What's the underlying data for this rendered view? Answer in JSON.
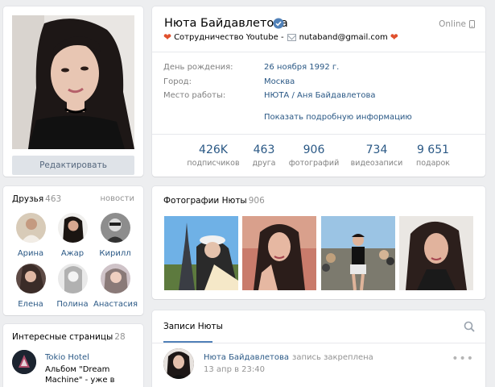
{
  "profile": {
    "name": "Нюта Байдавлетова",
    "online": "Online",
    "status_text": "Сотрудничество Youtube -",
    "status_email": "nutaband@gmail.com",
    "edit_button": "Редактировать",
    "info": [
      {
        "label": "День рождения:",
        "value": "26 ноября 1992 г."
      },
      {
        "label": "Город:",
        "value": "Москва"
      },
      {
        "label": "Место работы:",
        "value": "НЮТА / Аня Байдавлетова"
      }
    ],
    "show_more": "Показать подробную информацию",
    "counters": [
      {
        "value": "426K",
        "label": "подписчиков"
      },
      {
        "value": "463",
        "label": "друга"
      },
      {
        "value": "906",
        "label": "фотографий"
      },
      {
        "value": "734",
        "label": "видеозаписи"
      },
      {
        "value": "9 651",
        "label": "подарок"
      }
    ]
  },
  "friends": {
    "title": "Друзья",
    "count": "463",
    "link": "новости",
    "items": [
      {
        "name": "Арина"
      },
      {
        "name": "Ажар"
      },
      {
        "name": "Кирилл"
      },
      {
        "name": "Елена"
      },
      {
        "name": "Полина"
      },
      {
        "name": "Анастасия"
      }
    ]
  },
  "pages": {
    "title": "Интересные страницы",
    "count": "28",
    "items": [
      {
        "title": "Tokio Hotel",
        "desc": "Альбом \"Dream Machine\" - уже в группе. Клипы на"
      }
    ]
  },
  "photos": {
    "title": "Фотографии Нюты",
    "count": "906"
  },
  "wall": {
    "tab": "Записи Нюты",
    "post": {
      "author": "Нюта Байдавлетова",
      "pinned": "запись закреплена",
      "date": "13 апр в 23:40"
    }
  },
  "colors": {
    "link": "#2a5885",
    "accent": "#5181b8",
    "background": "#edeef0",
    "heart": "#e0502d"
  }
}
